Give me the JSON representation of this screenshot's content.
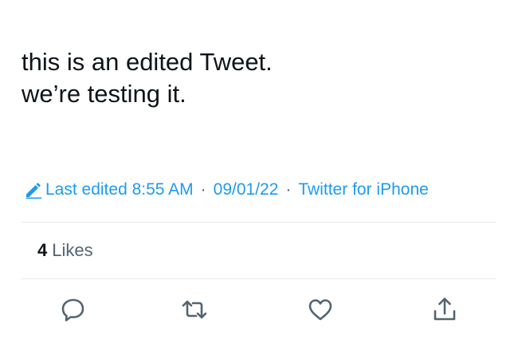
{
  "tweet": {
    "text_lines": [
      "this is an edited Tweet.",
      "we’re testing it."
    ]
  },
  "meta": {
    "edit_icon": "pencil-icon",
    "last_edited": "Last edited 8:55 AM",
    "separator": "·",
    "date": "09/01/22",
    "source": "Twitter for iPhone"
  },
  "engagement": {
    "likes_count": "4",
    "likes_label": "Likes"
  },
  "actions": [
    {
      "icon": "reply-icon"
    },
    {
      "icon": "retweet-icon"
    },
    {
      "icon": "like-icon"
    },
    {
      "icon": "share-icon"
    }
  ],
  "colors": {
    "accent": "#1d9bf0",
    "text": "#0f1419",
    "secondary_text": "#536471",
    "divider": "#e6ecf0"
  }
}
